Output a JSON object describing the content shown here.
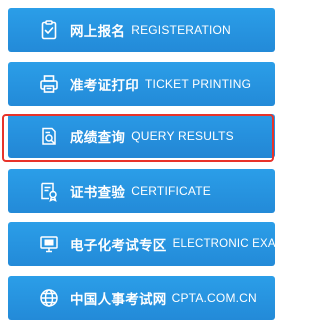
{
  "menu": {
    "items": [
      {
        "cn": "网上报名",
        "en": "REGISTERATION",
        "icon": "clipboard-icon"
      },
      {
        "cn": "准考证打印",
        "en": "TICKET PRINTING",
        "icon": "printer-icon"
      },
      {
        "cn": "成绩查询",
        "en": "QUERY RESULTS",
        "icon": "search-document-icon"
      },
      {
        "cn": "证书查验",
        "en": "CERTIFICATE",
        "icon": "certificate-icon"
      },
      {
        "cn": "电子化考试专区",
        "en": "ELECTRONIC EXAM",
        "icon": "monitor-icon"
      },
      {
        "cn": "中国人事考试网",
        "en": "CPTA.COM.CN",
        "icon": "globe-icon"
      }
    ],
    "highlighted_index": 2
  },
  "colors": {
    "button_blue": "#238ad8",
    "highlight_red": "#e8332a",
    "text": "#ffffff"
  }
}
